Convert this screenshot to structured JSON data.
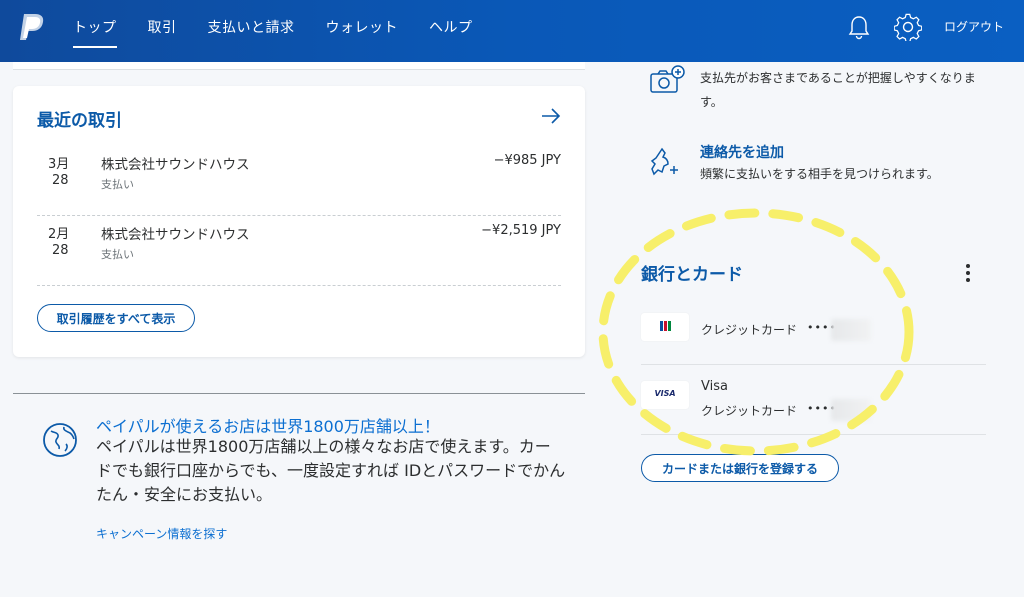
{
  "header": {
    "nav": [
      "トップ",
      "取引",
      "支払いと請求",
      "ウォレット",
      "ヘルプ"
    ],
    "active_index": 0,
    "logout_label": "ログアウト",
    "icons": [
      "paypal-logo",
      "bell-icon",
      "gear-icon"
    ]
  },
  "recent": {
    "title": "最近の取引",
    "transactions": [
      {
        "month": "3月",
        "day": "28",
        "name": "株式会社サウンドハウス",
        "type": "支払い",
        "amount": "−¥985 JPY"
      },
      {
        "month": "2月",
        "day": "28",
        "name": "株式会社サウンドハウス",
        "type": "支払い",
        "amount": "−¥2,519 JPY"
      }
    ],
    "view_all_label": "取引履歴をすべて表示"
  },
  "promo": {
    "title": "ペイパルが使えるお店は世界1800万店舗以上！",
    "text": "ペイパルは世界1800万店舗以上の様々なお店で使えます。カードでも銀行口座からでも、一度設定すれば IDとパスワードでかんたん・安全にお支払い。",
    "link_label": "キャンペーン情報を探す"
  },
  "side": {
    "photo_desc": "支払先がお客さまであることが把握しやすくなります。",
    "add_contact_label": "連絡先を追加",
    "add_contact_desc": "頻繁に支払いをする相手を見つけられます。"
  },
  "bank": {
    "title": "銀行とカード",
    "cards": [
      {
        "brand": "",
        "logo": "JCB",
        "label": "クレジットカード",
        "mask": "••••"
      },
      {
        "brand": "Visa",
        "logo": "VISA",
        "label": "クレジットカード",
        "mask": "••••"
      }
    ],
    "register_label": "カードまたは銀行を登録する"
  },
  "colors": {
    "header": "#0a58b7",
    "link": "#0c5aa8",
    "highlight": "#f7ef6a"
  }
}
